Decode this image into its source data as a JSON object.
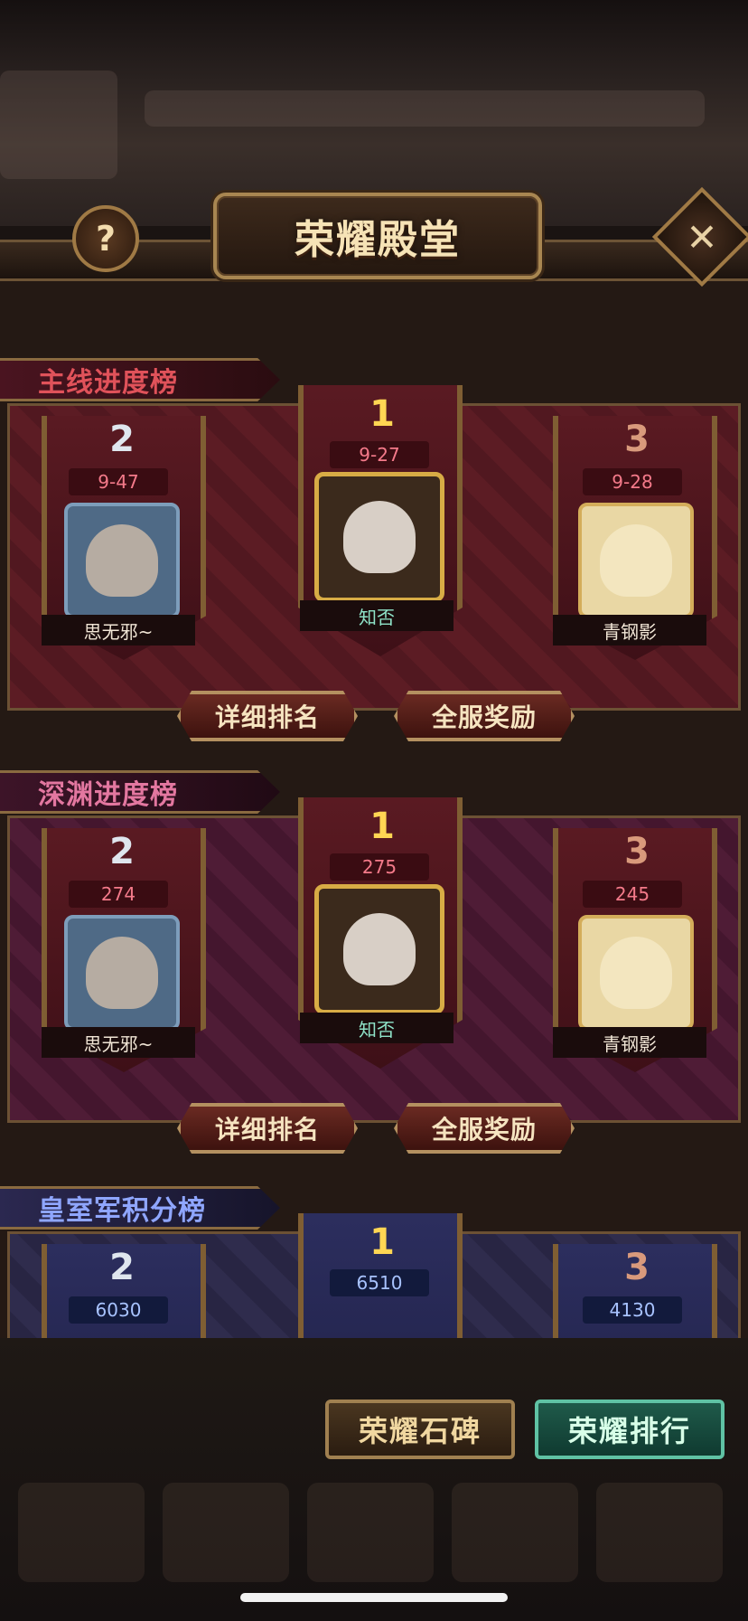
{
  "header": {
    "title": "荣耀殿堂",
    "help_icon": "?",
    "close_icon": "✕"
  },
  "colors": {
    "main": "#5a1a22",
    "abyss": "#4a1e36",
    "royal": "#2c2a4a"
  },
  "sections": [
    {
      "title": "主线进度榜",
      "ranks": [
        {
          "rank": "2",
          "score": "9-47",
          "name": "思无邪~"
        },
        {
          "rank": "1",
          "score": "9-27",
          "name": "知否"
        },
        {
          "rank": "3",
          "score": "9-28",
          "name": "青钢影"
        }
      ],
      "detail_button": "详细排名",
      "reward_button": "全服奖励"
    },
    {
      "title": "深渊进度榜",
      "ranks": [
        {
          "rank": "2",
          "score": "274",
          "name": "思无邪~"
        },
        {
          "rank": "1",
          "score": "275",
          "name": "知否"
        },
        {
          "rank": "3",
          "score": "245",
          "name": "青钢影"
        }
      ],
      "detail_button": "详细排名",
      "reward_button": "全服奖励"
    },
    {
      "title": "皇室军积分榜",
      "ranks": [
        {
          "rank": "2",
          "score": "6030"
        },
        {
          "rank": "1",
          "score": "6510"
        },
        {
          "rank": "3",
          "score": "4130"
        }
      ]
    }
  ],
  "footer": {
    "monument_button": "荣耀石碑",
    "ranking_button": "荣耀排行"
  }
}
